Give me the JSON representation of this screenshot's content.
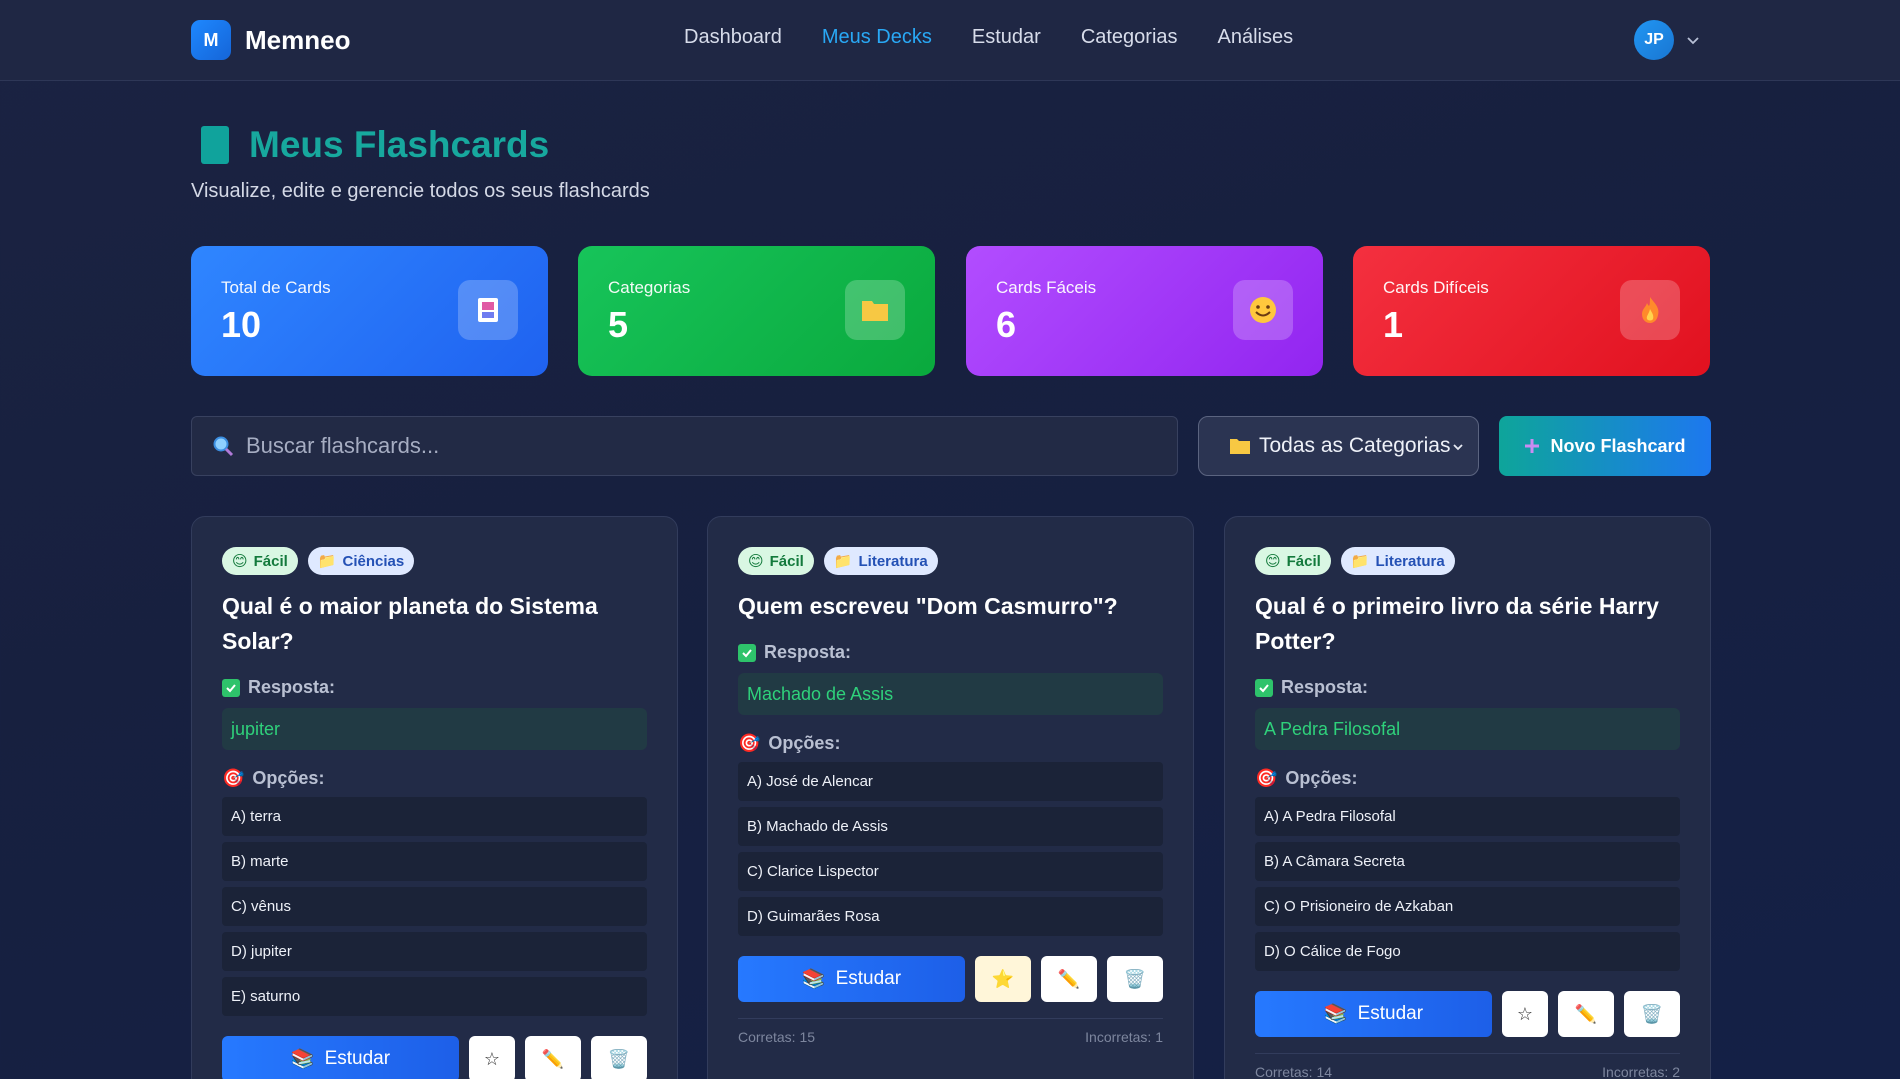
{
  "brand": {
    "logo_letter": "M",
    "name": "Memneo"
  },
  "nav": [
    "Dashboard",
    "Meus Decks",
    "Estudar",
    "Categorias",
    "Análises"
  ],
  "nav_active": "Meus Decks",
  "user": {
    "initials": "JP"
  },
  "page": {
    "title": "Meus Flashcards",
    "subtitle": "Visualize, edite e gerencie todos os seus flashcards"
  },
  "stats": [
    {
      "label": "Total de Cards",
      "value": "10",
      "icon": "cards-icon"
    },
    {
      "label": "Categorias",
      "value": "5",
      "icon": "folder-icon"
    },
    {
      "label": "Cards Fáceis",
      "value": "6",
      "icon": "smile-icon"
    },
    {
      "label": "Cards Difíceis",
      "value": "1",
      "icon": "fire-icon"
    }
  ],
  "toolbar": {
    "search_placeholder": "Buscar flashcards...",
    "category_select": "Todas as Categorias",
    "new_button": "Novo Flashcard"
  },
  "labels": {
    "answer": "Resposta:",
    "options": "Opções:",
    "study": "Estudar"
  },
  "cards": [
    {
      "difficulty": "Fácil",
      "category": "Ciências",
      "question": "Qual é o maior planeta do Sistema Solar?",
      "answer": "jupiter",
      "options": [
        "A) terra",
        "B) marte",
        "C) vênus",
        "D) jupiter",
        "E) saturno"
      ],
      "favorite": false,
      "correct": "",
      "incorrect": ""
    },
    {
      "difficulty": "Fácil",
      "category": "Literatura",
      "question": "Quem escreveu \"Dom Casmurro\"?",
      "answer": "Machado de Assis",
      "options": [
        "A) José de Alencar",
        "B) Machado de Assis",
        "C) Clarice Lispector",
        "D) Guimarães Rosa"
      ],
      "favorite": true,
      "correct": "Corretas: 15",
      "incorrect": "Incorretas: 1"
    },
    {
      "difficulty": "Fácil",
      "category": "Literatura",
      "question": "Qual é o primeiro livro da série Harry Potter?",
      "answer": "A Pedra Filosofal",
      "options": [
        "A) A Pedra Filosofal",
        "B) A Câmara Secreta",
        "C) O Prisioneiro de Azkaban",
        "D) O Cálice de Fogo"
      ],
      "favorite": false,
      "correct": "Corretas: 14",
      "incorrect": "Incorretas: 2"
    }
  ]
}
